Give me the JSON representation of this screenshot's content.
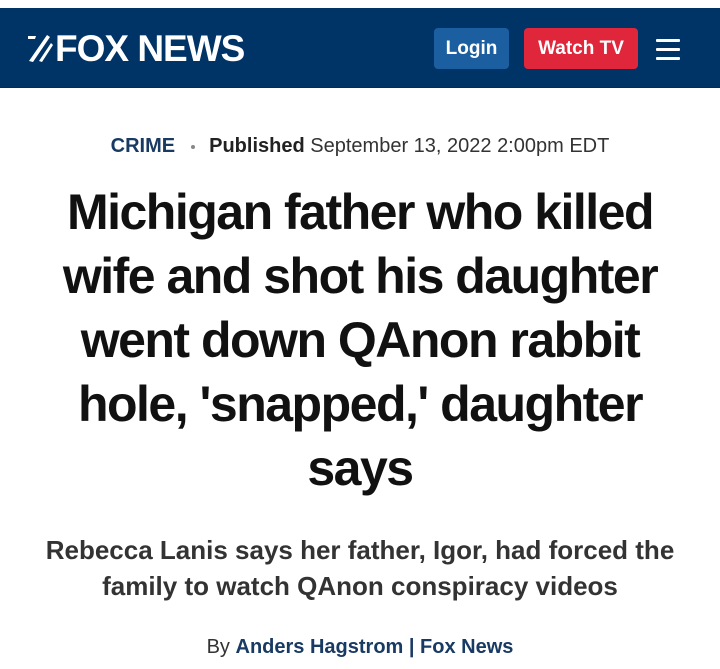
{
  "header": {
    "logo_text": "FOX NEWS",
    "login_label": "Login",
    "watch_label": "Watch TV",
    "colors": {
      "nav_bg": "#003366",
      "login_bg": "#1b5fa0",
      "watch_bg": "#e0263a"
    }
  },
  "article": {
    "category": "CRIME",
    "published_label": "Published",
    "published_date": "September 13, 2022 2:00pm EDT",
    "headline": "Michigan father who killed wife and shot his daughter went down QAnon rabbit hole, 'snapped,' daughter says",
    "subhead": "Rebecca Lanis says her father, Igor, had forced the family to watch QAnon conspiracy videos",
    "byline_prefix": "By",
    "author": "Anders Hagstrom",
    "separator": "|",
    "outlet": "Fox News"
  }
}
